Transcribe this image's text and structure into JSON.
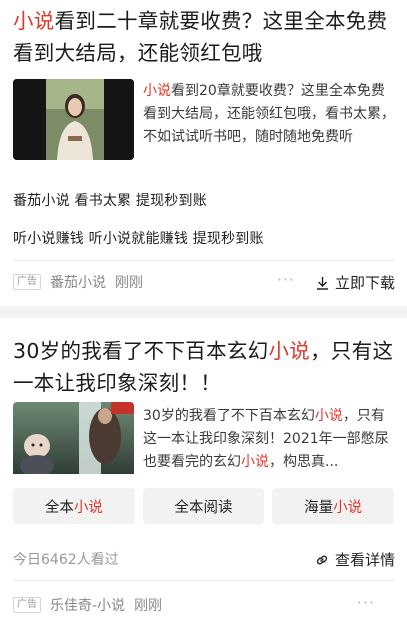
{
  "card1": {
    "title": {
      "hl": "小说",
      "rest": "看到二十章就要收费？这里全本免费看到大结局，还能领红包哦"
    },
    "desc": {
      "hl": "小说",
      "rest": "看到20章就要收费？这里全本免费看到大结局，还能领红包哦，看书太累，不如试试听书吧，随时随地免费听"
    },
    "line1": "番茄小说 看书太累 提现秒到账",
    "line2": "听小说赚钱 听小说就能赚钱 提现秒到账",
    "ad_badge": "广告",
    "source": "番茄小说",
    "time": "刚刚",
    "more": "···",
    "download_label": "立即下载"
  },
  "card2": {
    "title": {
      "pre": "30岁的我看了不下百本玄幻",
      "hl": "小说",
      "post": "，只有这一本让我印象深刻！！"
    },
    "desc": {
      "part1": "30岁的我看了不下百本玄幻",
      "hl1": "小说",
      "part2": "，只有这一本让我印象深刻！2021年一部憋尿也要看完的玄幻",
      "hl2": "小说",
      "part3": "，构思真..."
    },
    "buttons": [
      {
        "pre": "全本",
        "hl": "小说"
      },
      {
        "pre": "全本阅读",
        "hl": ""
      },
      {
        "pre": "海量",
        "hl": "小说"
      }
    ],
    "views": "今日6462人看过",
    "details_label": "查看详情",
    "ad_badge": "广告",
    "source": "乐佳奇-小说",
    "time": "刚刚",
    "more": "···"
  },
  "colors": {
    "highlight": "#e1372c",
    "divider": "#f4f4f4",
    "button_bg": "#f2f2f2"
  },
  "icons": [
    "download-icon",
    "link-icon",
    "more-icon"
  ]
}
